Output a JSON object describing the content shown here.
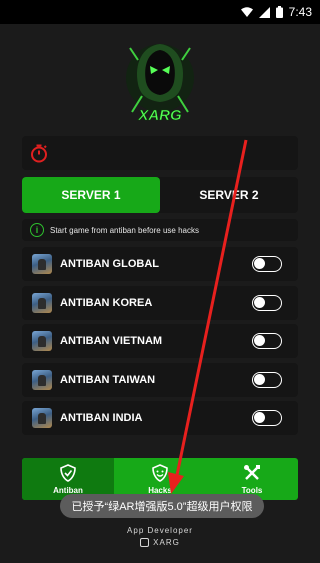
{
  "status_bar": {
    "time": "7:43"
  },
  "logo": {
    "text": "XARG"
  },
  "servers": [
    {
      "label": "SERVER 1",
      "active": true
    },
    {
      "label": "SERVER 2",
      "active": false
    }
  ],
  "info": {
    "text": "Start game from antiban before use hacks"
  },
  "antiban_items": [
    {
      "label": "ANTIBAN GLOBAL",
      "enabled": false
    },
    {
      "label": "ANTIBAN KOREA",
      "enabled": false
    },
    {
      "label": "ANTIBAN VIETNAM",
      "enabled": false
    },
    {
      "label": "ANTIBAN TAIWAN",
      "enabled": false
    },
    {
      "label": "ANTIBAN INDIA",
      "enabled": false
    }
  ],
  "nav": [
    {
      "label": "Antiban",
      "icon": "shield-icon",
      "active": true
    },
    {
      "label": "Hacks",
      "icon": "smile-shield-icon",
      "active": false
    },
    {
      "label": "Tools",
      "icon": "tools-icon",
      "active": false
    }
  ],
  "toast": {
    "text": "已授予“绿AR增强版5.0”超级用户权限"
  },
  "footer": {
    "title": "App Developer",
    "brand": "XARG"
  },
  "colors": {
    "accent": "#17a918",
    "background": "#1b1b1b",
    "card": "#151515",
    "timer": "#e02020",
    "arrow": "#e8201e"
  }
}
